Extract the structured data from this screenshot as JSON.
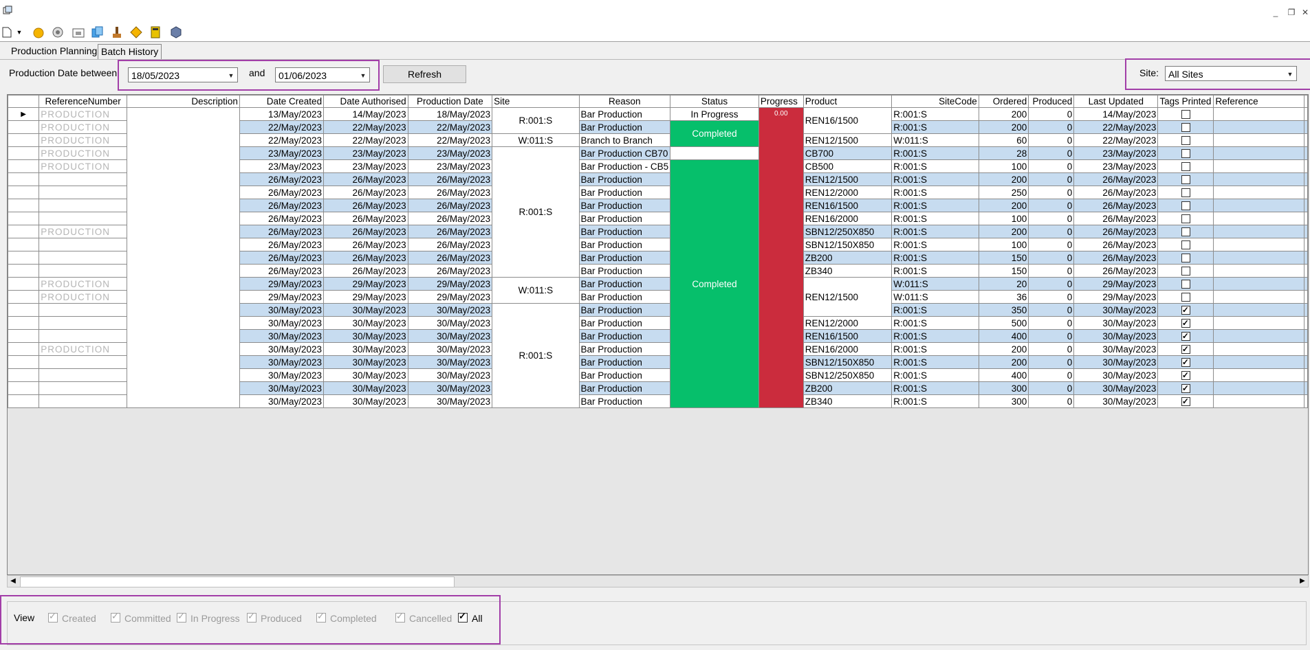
{
  "tabs": [
    "Production Planning",
    "Batch History"
  ],
  "filter": {
    "label": "Production Date between",
    "from": "18/05/2023",
    "and_label": "and",
    "to": "01/06/2023",
    "refresh": "Refresh",
    "site_label": "Site:",
    "site_value": "All Sites"
  },
  "columns": [
    "ReferenceNumber",
    "Description",
    "Date Created",
    "Date Authorised",
    "Production Date",
    "Site",
    "Reason",
    "Status",
    "Progress",
    "Product",
    "SiteCode",
    "Ordered",
    "Produced",
    "Last Updated",
    "Tags Printed",
    "Reference"
  ],
  "rows": [
    {
      "ref": "PRODUCTION",
      "created": "13/May/2023",
      "authorised": "14/May/2023",
      "production": "18/May/2023",
      "reason": "Bar Production",
      "product": "REN16/1500",
      "sitecode": "R:001:S",
      "ordered": "200",
      "produced": "0",
      "updated": "14/May/2023",
      "tags": false
    },
    {
      "ref": "PRODUCTION",
      "created": "22/May/2023",
      "authorised": "22/May/2023",
      "production": "22/May/2023",
      "reason": "Bar Production",
      "product": "",
      "sitecode": "R:001:S",
      "ordered": "200",
      "produced": "0",
      "updated": "22/May/2023",
      "tags": false
    },
    {
      "ref": "PRODUCTION",
      "created": "22/May/2023",
      "authorised": "22/May/2023",
      "production": "22/May/2023",
      "reason": "Branch to Branch",
      "product": "REN12/1500",
      "sitecode": "W:011:S",
      "ordered": "60",
      "produced": "0",
      "updated": "22/May/2023",
      "tags": false
    },
    {
      "ref": "PRODUCTION",
      "created": "23/May/2023",
      "authorised": "23/May/2023",
      "production": "23/May/2023",
      "reason": "Bar Production CB70",
      "product": "CB700",
      "sitecode": "R:001:S",
      "ordered": "28",
      "produced": "0",
      "updated": "23/May/2023",
      "tags": false
    },
    {
      "ref": "PRODUCTION",
      "created": "23/May/2023",
      "authorised": "23/May/2023",
      "production": "23/May/2023",
      "reason": "Bar Production - CB5",
      "product": "CB500",
      "sitecode": "R:001:S",
      "ordered": "100",
      "produced": "0",
      "updated": "23/May/2023",
      "tags": false
    },
    {
      "ref": "",
      "created": "26/May/2023",
      "authorised": "26/May/2023",
      "production": "26/May/2023",
      "reason": "Bar Production",
      "product": "REN12/1500",
      "sitecode": "R:001:S",
      "ordered": "200",
      "produced": "0",
      "updated": "26/May/2023",
      "tags": false
    },
    {
      "ref": "",
      "created": "26/May/2023",
      "authorised": "26/May/2023",
      "production": "26/May/2023",
      "reason": "Bar Production",
      "product": "REN12/2000",
      "sitecode": "R:001:S",
      "ordered": "250",
      "produced": "0",
      "updated": "26/May/2023",
      "tags": false
    },
    {
      "ref": "",
      "created": "26/May/2023",
      "authorised": "26/May/2023",
      "production": "26/May/2023",
      "reason": "Bar Production",
      "product": "REN16/1500",
      "sitecode": "R:001:S",
      "ordered": "200",
      "produced": "0",
      "updated": "26/May/2023",
      "tags": false
    },
    {
      "ref": "",
      "created": "26/May/2023",
      "authorised": "26/May/2023",
      "production": "26/May/2023",
      "reason": "Bar Production",
      "product": "REN16/2000",
      "sitecode": "R:001:S",
      "ordered": "100",
      "produced": "0",
      "updated": "26/May/2023",
      "tags": false
    },
    {
      "ref": "PRODUCTION",
      "created": "26/May/2023",
      "authorised": "26/May/2023",
      "production": "26/May/2023",
      "reason": "Bar Production",
      "product": "SBN12/250X850",
      "sitecode": "R:001:S",
      "ordered": "200",
      "produced": "0",
      "updated": "26/May/2023",
      "tags": false
    },
    {
      "ref": "",
      "created": "26/May/2023",
      "authorised": "26/May/2023",
      "production": "26/May/2023",
      "reason": "Bar Production",
      "product": "SBN12/150X850",
      "sitecode": "R:001:S",
      "ordered": "100",
      "produced": "0",
      "updated": "26/May/2023",
      "tags": false
    },
    {
      "ref": "",
      "created": "26/May/2023",
      "authorised": "26/May/2023",
      "production": "26/May/2023",
      "reason": "Bar Production",
      "product": "ZB200",
      "sitecode": "R:001:S",
      "ordered": "150",
      "produced": "0",
      "updated": "26/May/2023",
      "tags": false
    },
    {
      "ref": "",
      "created": "26/May/2023",
      "authorised": "26/May/2023",
      "production": "26/May/2023",
      "reason": "Bar Production",
      "product": "ZB340",
      "sitecode": "R:001:S",
      "ordered": "150",
      "produced": "0",
      "updated": "26/May/2023",
      "tags": false
    },
    {
      "ref": "PRODUCTION",
      "created": "29/May/2023",
      "authorised": "29/May/2023",
      "production": "29/May/2023",
      "reason": "Bar Production",
      "product": "REN12/1500",
      "sitecode": "W:011:S",
      "ordered": "20",
      "produced": "0",
      "updated": "29/May/2023",
      "tags": false
    },
    {
      "ref": "PRODUCTION",
      "created": "29/May/2023",
      "authorised": "29/May/2023",
      "production": "29/May/2023",
      "reason": "Bar Production",
      "product": "",
      "sitecode": "W:011:S",
      "ordered": "36",
      "produced": "0",
      "updated": "29/May/2023",
      "tags": false
    },
    {
      "ref": "",
      "created": "30/May/2023",
      "authorised": "30/May/2023",
      "production": "30/May/2023",
      "reason": "Bar Production",
      "product": "",
      "sitecode": "R:001:S",
      "ordered": "350",
      "produced": "0",
      "updated": "30/May/2023",
      "tags": true
    },
    {
      "ref": "",
      "created": "30/May/2023",
      "authorised": "30/May/2023",
      "production": "30/May/2023",
      "reason": "Bar Production",
      "product": "REN12/2000",
      "sitecode": "R:001:S",
      "ordered": "500",
      "produced": "0",
      "updated": "30/May/2023",
      "tags": true
    },
    {
      "ref": "",
      "created": "30/May/2023",
      "authorised": "30/May/2023",
      "production": "30/May/2023",
      "reason": "Bar Production",
      "product": "REN16/1500",
      "sitecode": "R:001:S",
      "ordered": "400",
      "produced": "0",
      "updated": "30/May/2023",
      "tags": true
    },
    {
      "ref": "PRODUCTION",
      "created": "30/May/2023",
      "authorised": "30/May/2023",
      "production": "30/May/2023",
      "reason": "Bar Production",
      "product": "REN16/2000",
      "sitecode": "R:001:S",
      "ordered": "200",
      "produced": "0",
      "updated": "30/May/2023",
      "tags": true
    },
    {
      "ref": "",
      "created": "30/May/2023",
      "authorised": "30/May/2023",
      "production": "30/May/2023",
      "reason": "Bar Production",
      "product": "SBN12/150X850",
      "sitecode": "R:001:S",
      "ordered": "200",
      "produced": "0",
      "updated": "30/May/2023",
      "tags": true
    },
    {
      "ref": "",
      "created": "30/May/2023",
      "authorised": "30/May/2023",
      "production": "30/May/2023",
      "reason": "Bar Production",
      "product": "SBN12/250X850",
      "sitecode": "R:001:S",
      "ordered": "400",
      "produced": "0",
      "updated": "30/May/2023",
      "tags": true
    },
    {
      "ref": "",
      "created": "30/May/2023",
      "authorised": "30/May/2023",
      "production": "30/May/2023",
      "reason": "Bar Production",
      "product": "ZB200",
      "sitecode": "R:001:S",
      "ordered": "300",
      "produced": "0",
      "updated": "30/May/2023",
      "tags": true
    },
    {
      "ref": "",
      "created": "30/May/2023",
      "authorised": "30/May/2023",
      "production": "30/May/2023",
      "reason": "Bar Production",
      "product": "ZB340",
      "sitecode": "R:001:S",
      "ordered": "300",
      "produced": "0",
      "updated": "30/May/2023",
      "tags": true
    }
  ],
  "merged": {
    "site_a": "R:001:S",
    "site_b": "W:011:S",
    "site_c": "R:001:S",
    "site_d": "W:011:S",
    "site_e": "R:001:S",
    "status_inprogress": "In Progress",
    "status_completed_a": "Completed",
    "status_completed_b": "Completed",
    "progress_value": "0.00",
    "product_top": "REN16/1500",
    "product_bottom": "REN12/1500"
  },
  "view": {
    "label": "View",
    "options": [
      "Created",
      "Committed",
      "In Progress",
      "Produced",
      "Completed",
      "Cancelled",
      "All"
    ]
  },
  "colors": {
    "completed": "#06bf6b",
    "progress": "#cb2c3d",
    "row_alt": "#c7dcf0",
    "highlight": "#a23ea8"
  }
}
